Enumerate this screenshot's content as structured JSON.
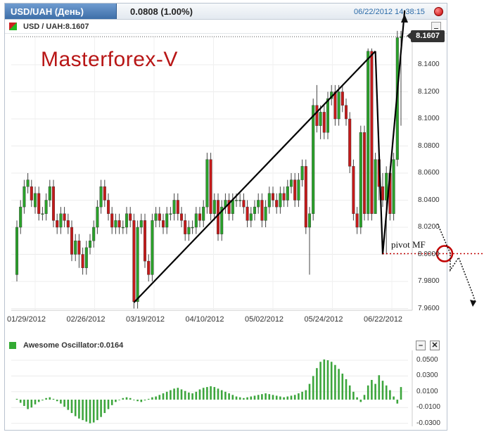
{
  "window": {
    "symbol_tab": "USD/UAH (День)",
    "change": "0.0808 (1.00%)",
    "timestamp": "06/22/2012 14:38:15"
  },
  "main_panel": {
    "legend": "USD / UAH:8.1607",
    "watermark": "Masterforex-V",
    "price_badge": "8.1607",
    "pivot_label": "pivot MF"
  },
  "indicator_panel": {
    "legend": "Awesome Oscillator:0.0164",
    "close_label": "✕"
  },
  "colors": {
    "up": "#2aa12a",
    "down": "#c41a1a",
    "line": "#000000",
    "oscillator": "#3da63d",
    "pivot_marker": "#c00000"
  },
  "chart_data": [
    {
      "type": "candlestick",
      "title": "USD / UAH",
      "x_tick_labels": [
        "01/29/2012",
        "02/26/2012",
        "03/19/2012",
        "04/10/2012",
        "05/02/2012",
        "05/24/2012",
        "06/22/2012"
      ],
      "y_tick_labels": [
        "8.1400",
        "8.1200",
        "8.1000",
        "8.0800",
        "8.0600",
        "8.0400",
        "8.0200",
        "8.0000",
        "7.9800",
        "7.9600"
      ],
      "ylim": [
        7.96,
        8.16
      ],
      "last_value": 8.1607,
      "open": [
        7.985,
        8.02,
        8.035,
        8.05,
        8.05,
        8.035,
        8.045,
        8.03,
        8.03,
        8.04,
        8.05,
        8.025,
        8.02,
        8.03,
        8.025,
        8.02,
        8.0,
        8.01,
        8.0,
        7.99,
        8.005,
        8.01,
        8.02,
        8.035,
        8.05,
        8.04,
        8.03,
        8.02,
        8.025,
        8.02,
        8.02,
        8.03,
        8.025,
        7.965,
        8.02,
        8.025,
        7.995,
        7.985,
        8.025,
        8.03,
        8.025,
        8.02,
        8.03,
        8.03,
        8.04,
        8.03,
        8.025,
        8.015,
        8.02,
        8.02,
        8.03,
        8.025,
        8.035,
        8.07,
        8.03,
        8.04,
        8.015,
        8.035,
        8.04,
        8.03,
        8.04,
        8.04,
        8.04,
        8.035,
        8.025,
        8.03,
        8.035,
        8.04,
        8.025,
        8.035,
        8.045,
        8.04,
        8.035,
        8.045,
        8.04,
        8.05,
        8.055,
        8.04,
        8.055,
        8.065,
        8.02,
        8.03,
        8.11,
        8.095,
        8.105,
        8.09,
        8.115,
        8.12,
        8.1,
        8.12,
        8.11,
        8.1,
        8.065,
        8.03,
        8.02,
        8.09,
        8.03,
        8.15,
        8.03,
        8.07,
        8.05,
        8.04,
        8.06,
        8.03,
        8.07,
        8.16
      ],
      "close": [
        8.02,
        8.035,
        8.05,
        8.055,
        8.04,
        8.045,
        8.03,
        8.03,
        8.04,
        8.05,
        8.025,
        8.02,
        8.03,
        8.025,
        8.02,
        8.0,
        8.01,
        8.0,
        7.99,
        8.005,
        8.01,
        8.02,
        8.035,
        8.05,
        8.04,
        8.03,
        8.02,
        8.025,
        8.02,
        8.02,
        8.03,
        8.025,
        7.965,
        8.02,
        8.025,
        7.995,
        7.985,
        8.025,
        8.03,
        8.025,
        8.02,
        8.03,
        8.03,
        8.04,
        8.03,
        8.025,
        8.015,
        8.02,
        8.02,
        8.03,
        8.025,
        8.035,
        8.07,
        8.03,
        8.04,
        8.015,
        8.035,
        8.04,
        8.03,
        8.04,
        8.04,
        8.04,
        8.035,
        8.025,
        8.03,
        8.035,
        8.04,
        8.025,
        8.035,
        8.045,
        8.04,
        8.035,
        8.045,
        8.04,
        8.05,
        8.055,
        8.04,
        8.055,
        8.065,
        8.02,
        8.03,
        8.11,
        8.095,
        8.105,
        8.09,
        8.115,
        8.12,
        8.1,
        8.12,
        8.11,
        8.1,
        8.065,
        8.03,
        8.02,
        8.09,
        8.03,
        8.15,
        8.03,
        8.07,
        8.05,
        8.04,
        8.06,
        8.03,
        8.07,
        8.16,
        8.1607
      ],
      "high": [
        8.025,
        8.04,
        8.055,
        8.06,
        8.055,
        8.05,
        8.05,
        8.035,
        8.045,
        8.055,
        8.055,
        8.03,
        8.035,
        8.035,
        8.03,
        8.025,
        8.015,
        8.015,
        8.005,
        8.01,
        8.015,
        8.025,
        8.04,
        8.055,
        8.055,
        8.045,
        8.035,
        8.03,
        8.03,
        8.025,
        8.035,
        8.035,
        8.03,
        8.025,
        8.03,
        8.03,
        8.0,
        8.03,
        8.035,
        8.035,
        8.03,
        8.035,
        8.035,
        8.045,
        8.045,
        8.035,
        8.03,
        8.025,
        8.025,
        8.035,
        8.035,
        8.04,
        8.075,
        8.075,
        8.045,
        8.045,
        8.04,
        8.045,
        8.045,
        8.045,
        8.045,
        8.045,
        8.045,
        8.04,
        8.035,
        8.04,
        8.045,
        8.045,
        8.04,
        8.05,
        8.05,
        8.045,
        8.05,
        8.05,
        8.055,
        8.06,
        8.06,
        8.06,
        8.07,
        8.07,
        8.035,
        8.115,
        8.125,
        8.11,
        8.11,
        8.12,
        8.125,
        8.125,
        8.125,
        8.125,
        8.115,
        8.105,
        8.07,
        8.035,
        8.095,
        8.095,
        8.152,
        8.152,
        8.075,
        8.075,
        8.06,
        8.065,
        8.065,
        8.075,
        8.165,
        8.165
      ],
      "low": [
        7.98,
        8.015,
        8.03,
        8.045,
        8.035,
        8.03,
        8.025,
        8.025,
        8.025,
        8.035,
        8.02,
        8.015,
        8.015,
        8.02,
        8.015,
        7.995,
        7.995,
        7.99,
        7.985,
        7.985,
        8.0,
        8.005,
        8.015,
        8.03,
        8.035,
        8.025,
        8.015,
        8.015,
        8.015,
        8.015,
        8.015,
        8.02,
        7.96,
        7.96,
        8.015,
        7.99,
        7.98,
        7.98,
        8.02,
        8.02,
        8.015,
        8.015,
        8.025,
        8.025,
        8.025,
        8.02,
        8.01,
        8.01,
        8.015,
        8.015,
        8.02,
        8.02,
        8.03,
        8.025,
        8.025,
        8.01,
        8.01,
        8.03,
        8.025,
        8.025,
        8.035,
        8.035,
        8.03,
        8.02,
        8.02,
        8.025,
        8.03,
        8.02,
        8.02,
        8.03,
        8.035,
        8.03,
        8.03,
        8.035,
        8.035,
        8.045,
        8.035,
        8.035,
        8.05,
        8.015,
        7.985,
        8.025,
        8.09,
        8.085,
        8.085,
        8.085,
        8.11,
        8.095,
        8.095,
        8.105,
        8.095,
        8.06,
        8.025,
        8.015,
        8.015,
        8.025,
        8.025,
        8.025,
        8.045,
        8.04,
        8.035,
        8.0,
        8.025,
        8.025,
        8.065,
        8.095
      ],
      "trendlines": [
        {
          "from": [
            32,
            7.9645
          ],
          "to": [
            98,
            8.15
          ]
        },
        {
          "from": [
            98,
            8.15
          ],
          "to": [
            100,
            8.0
          ]
        },
        {
          "from": [
            100,
            8.0
          ],
          "to": [
            106,
            8.18
          ]
        }
      ],
      "pivot_level": 8.0005
    },
    {
      "type": "bar",
      "title": "Awesome Oscillator",
      "y_tick_labels": [
        "0.0500",
        "0.0300",
        "0.0100",
        "-0.0100",
        "-0.0300"
      ],
      "ylim": [
        -0.032,
        0.056
      ],
      "last_value": 0.0164,
      "values": [
        0.001,
        -0.004,
        -0.008,
        -0.012,
        -0.01,
        -0.006,
        -0.003,
        -0.001,
        0.002,
        0.003,
        0.001,
        -0.002,
        -0.005,
        -0.009,
        -0.013,
        -0.017,
        -0.021,
        -0.024,
        -0.026,
        -0.028,
        -0.03,
        -0.029,
        -0.026,
        -0.022,
        -0.017,
        -0.012,
        -0.007,
        -0.003,
        0.0,
        0.002,
        0.003,
        0.002,
        0.0,
        -0.002,
        -0.003,
        -0.001,
        0.001,
        0.003,
        0.004,
        0.006,
        0.008,
        0.01,
        0.012,
        0.014,
        0.015,
        0.013,
        0.011,
        0.009,
        0.008,
        0.01,
        0.013,
        0.015,
        0.016,
        0.017,
        0.016,
        0.014,
        0.012,
        0.01,
        0.008,
        0.006,
        0.004,
        0.003,
        0.002,
        0.003,
        0.004,
        0.005,
        0.006,
        0.007,
        0.008,
        0.007,
        0.006,
        0.005,
        0.004,
        0.003,
        0.004,
        0.005,
        0.006,
        0.008,
        0.01,
        0.012,
        0.02,
        0.03,
        0.04,
        0.048,
        0.051,
        0.05,
        0.048,
        0.044,
        0.039,
        0.033,
        0.026,
        0.018,
        0.01,
        0.003,
        -0.003,
        0.006,
        0.018,
        0.025,
        0.02,
        0.031,
        0.024,
        0.018,
        0.012,
        0.004,
        -0.005,
        0.016
      ]
    }
  ]
}
